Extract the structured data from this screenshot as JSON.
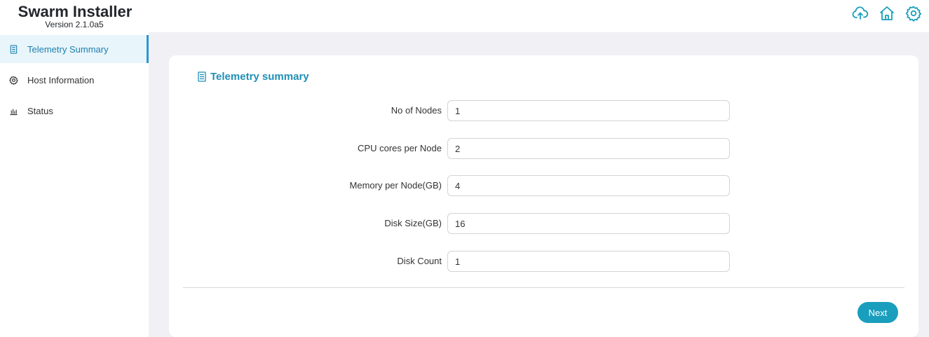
{
  "app": {
    "title": "Swarm Installer",
    "version": "Version 2.1.0a5"
  },
  "header": {
    "icons": [
      "cloud-upload-icon",
      "home-icon",
      "gear-icon"
    ],
    "accent_color": "#1a9ebd"
  },
  "sidebar": {
    "items": [
      {
        "label": "Telemetry Summary",
        "icon": "document-icon",
        "active": true
      },
      {
        "label": "Host Information",
        "icon": "gear-icon",
        "active": false
      },
      {
        "label": "Status",
        "icon": "bar-chart-icon",
        "active": false
      }
    ]
  },
  "main": {
    "title": "Telemetry summary",
    "fields": [
      {
        "label": "No of Nodes",
        "value": "1"
      },
      {
        "label": "CPU cores per Node",
        "value": "2"
      },
      {
        "label": "Memory per Node(GB)",
        "value": "4"
      },
      {
        "label": "Disk Size(GB)",
        "value": "16"
      },
      {
        "label": "Disk Count",
        "value": "1"
      }
    ],
    "next_label": "Next"
  }
}
